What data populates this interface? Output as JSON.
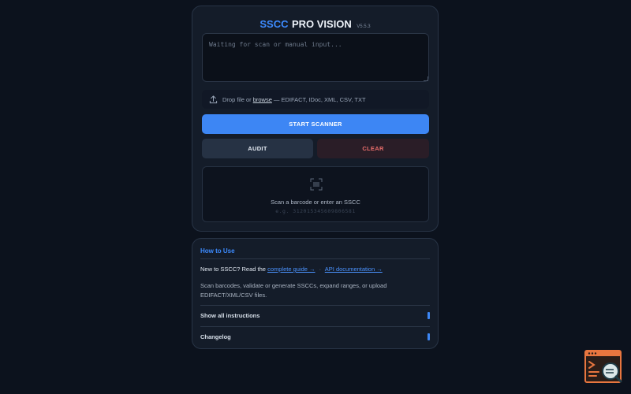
{
  "app": {
    "brand": "SSCC",
    "product": "PRO VISION",
    "version": "V5.5.3"
  },
  "scanner": {
    "placeholder": "Waiting for scan or manual input...",
    "value": ""
  },
  "dropzone": {
    "prefix": "Drop file or",
    "browse_label": "browse",
    "suffix": "— EDIFACT, IDoc, XML, CSV, TXT"
  },
  "buttons": {
    "start": "START SCANNER",
    "audit": "AUDIT",
    "clear": "CLEAR"
  },
  "result": {
    "prompt": "Scan a barcode or enter an SSCC",
    "example": "e.g. 312015345609806581"
  },
  "help": {
    "title": "How to Use",
    "intro": "New to SSCC? Read the",
    "guide_link": "complete guide →",
    "separator": "·",
    "api_link": "API documentation →",
    "description": "Scan barcodes, validate or generate SSCCs, expand ranges, or upload EDIFACT/XML/CSV files.",
    "sections": [
      {
        "label": "Show all instructions"
      },
      {
        "label": "Changelog"
      }
    ]
  },
  "icons": {
    "upload": "upload-icon",
    "barcode": "barcode-scan-icon",
    "fab": "browser-search-icon"
  },
  "colors": {
    "accent": "#3d86f4",
    "danger": "#e86d6b",
    "fab": "#e8763f"
  }
}
